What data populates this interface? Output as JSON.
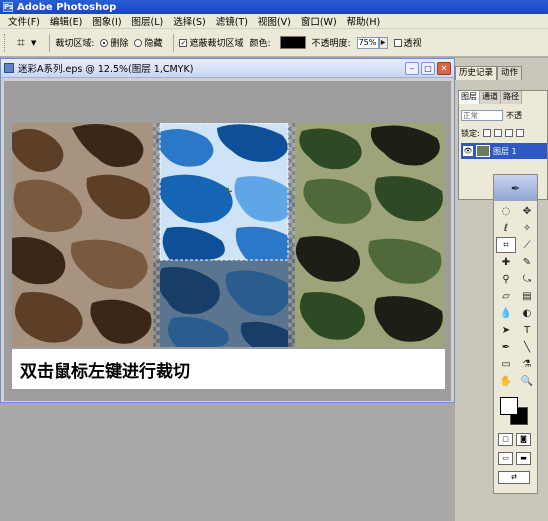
{
  "window": {
    "app_title": "Adobe Photoshop",
    "logo_text": "Ps"
  },
  "menubar": {
    "items": [
      {
        "label": "文件(F)"
      },
      {
        "label": "编辑(E)"
      },
      {
        "label": "图象(I)"
      },
      {
        "label": "图层(L)"
      },
      {
        "label": "选择(S)"
      },
      {
        "label": "滤镜(T)"
      },
      {
        "label": "视图(V)"
      },
      {
        "label": "窗口(W)"
      },
      {
        "label": "帮助(H)"
      }
    ]
  },
  "options": {
    "crop_area_label": "裁切区域:",
    "delete_label": "删除",
    "hide_label": "隐藏",
    "shield_label": "遮蔽裁切区域",
    "color_label": "颜色:",
    "shield_color": "#000000",
    "opacity_label": "不透明度:",
    "opacity_value": "75%",
    "perspective_label": "透视",
    "delete_selected": true,
    "shield_checked": true,
    "perspective_checked": false
  },
  "document": {
    "title": "迷彩A系列.eps @ 12.5%(图层 1,CMYK)",
    "caption": "双击鼠标左键进行裁切"
  },
  "panels": {
    "top_tabs": [
      "历史记录",
      "动作"
    ],
    "layer_tabs": [
      "图层",
      "通道",
      "路径"
    ],
    "blend_mode": "正常",
    "opacity_short": "不透",
    "lock_label": "锁定:",
    "layer_name": "图层 1"
  },
  "colors": {
    "titlebar": "#2a5fd6",
    "foreground": "#ffffff",
    "background": "#000000",
    "layer_selected": "#2f59c2"
  }
}
